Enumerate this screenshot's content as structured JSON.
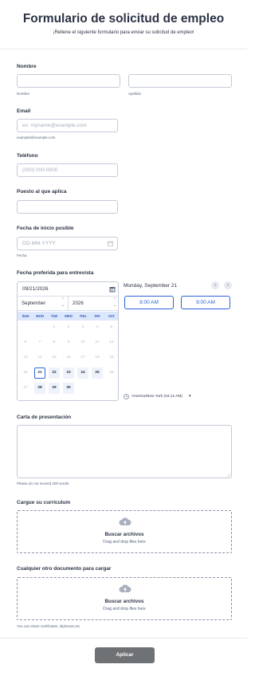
{
  "form": {
    "title": "Formulario de solicitud de empleo",
    "subtitle": "¡Rellene el siguiente formulario para enviar su solicitud de empleo!",
    "name": {
      "label": "Nombre",
      "first_sub": "Nombre",
      "last_sub": "Apellido"
    },
    "email": {
      "label": "Email",
      "placeholder": "ex: myname@example.com",
      "sub": "example@example.com"
    },
    "phone": {
      "label": "Teléfono",
      "placeholder": "(000) 000-0000"
    },
    "position": {
      "label": "Puesto al que aplica"
    },
    "start": {
      "label": "Fecha de inicio posible",
      "placeholder": "DD-MM-YYYY",
      "sub": "Fecha"
    },
    "interview": {
      "label": "Fecha preferida para entrevista",
      "date_value": "09/21/2026",
      "month": "September",
      "year": "2026",
      "weekdays": [
        "SUN",
        "MON",
        "TUE",
        "WED",
        "THU",
        "FRI",
        "SAT"
      ],
      "day_heading": "Monday, September 21",
      "times": [
        "8:00 AM",
        "9:00 AM"
      ],
      "timezone": "America/New York (04:12 AM)"
    },
    "cover": {
      "label": "Carta de presentación",
      "sub": "Please do not exceed 200 words."
    },
    "resume": {
      "label": "Cargue su currículum",
      "button": "Buscar archivos",
      "hint": "Drag and drop files here"
    },
    "other": {
      "label": "Cualquier otro documento para cargar",
      "button": "Buscar archivos",
      "hint": "Drag and drop files here",
      "sub": "You can share certificates, diplomas etc."
    },
    "submit": "Aplicar"
  },
  "calendar": {
    "days": [
      {
        "d": "",
        "on": false
      },
      {
        "d": "",
        "on": false
      },
      {
        "d": "1",
        "on": false
      },
      {
        "d": "2",
        "on": false
      },
      {
        "d": "3",
        "on": false
      },
      {
        "d": "4",
        "on": false
      },
      {
        "d": "5",
        "on": false
      },
      {
        "d": "6",
        "on": false
      },
      {
        "d": "7",
        "on": false
      },
      {
        "d": "8",
        "on": false
      },
      {
        "d": "9",
        "on": false
      },
      {
        "d": "10",
        "on": false
      },
      {
        "d": "11",
        "on": false
      },
      {
        "d": "12",
        "on": false
      },
      {
        "d": "13",
        "on": false
      },
      {
        "d": "14",
        "on": false
      },
      {
        "d": "15",
        "on": false
      },
      {
        "d": "16",
        "on": false
      },
      {
        "d": "17",
        "on": false
      },
      {
        "d": "18",
        "on": false
      },
      {
        "d": "19",
        "on": false
      },
      {
        "d": "20",
        "on": false
      },
      {
        "d": "21",
        "on": true,
        "sel": true
      },
      {
        "d": "22",
        "on": true
      },
      {
        "d": "23",
        "on": true
      },
      {
        "d": "24",
        "on": true
      },
      {
        "d": "25",
        "on": true
      },
      {
        "d": "26",
        "on": false
      },
      {
        "d": "27",
        "on": false
      },
      {
        "d": "28",
        "on": true
      },
      {
        "d": "29",
        "on": true
      },
      {
        "d": "30",
        "on": true
      },
      {
        "d": "",
        "on": false
      },
      {
        "d": "",
        "on": false
      },
      {
        "d": "",
        "on": false
      }
    ]
  },
  "colors": {
    "accent": "#2b64db",
    "button": "#6f7275",
    "border": "#c3cad8"
  }
}
